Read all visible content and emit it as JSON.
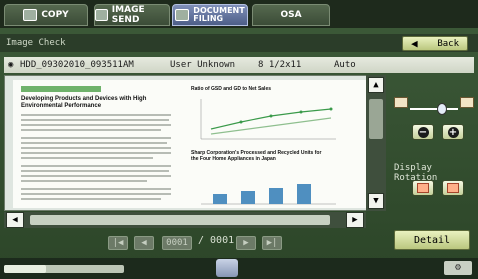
{
  "tabs": [
    {
      "label": "COPY",
      "active": false
    },
    {
      "label": "IMAGE SEND",
      "active": false
    },
    {
      "label_line1": "DOCUMENT",
      "label_line2": "FILING",
      "active": true
    },
    {
      "label": "OSA",
      "active": false
    }
  ],
  "title": "Image Check",
  "back_label": "Back",
  "file": {
    "name": "HDD_09302010_093511AM",
    "user": "User Unknown",
    "paper_size": "8 1/2x11",
    "mode": "Auto"
  },
  "document_preview": {
    "heading_line1": "Developing Products and Devices with High",
    "heading_line2": "Environmental Performance",
    "chart1_title": "Ratio of GSD and GD to Net Sales",
    "chart2_title_line1": "Sharp Corporation's Processed and Recycled Units for",
    "chart2_title_line2": "the Four Home Appliances in Japan"
  },
  "page_nav": {
    "current": "0001",
    "total": "/ 0001"
  },
  "rotation_label": "Display Rotation",
  "detail_label": "Detail",
  "zoom_level": 0.7,
  "progress": 0.35,
  "icons": [
    "folder-icon",
    "disk-icon",
    "back-arrow-icon",
    "zoom-out-icon",
    "zoom-in-icon",
    "rotate-left-icon",
    "rotate-right-icon",
    "first-page-icon",
    "prev-page-icon",
    "next-page-icon",
    "last-page-icon",
    "gear-icon"
  ]
}
